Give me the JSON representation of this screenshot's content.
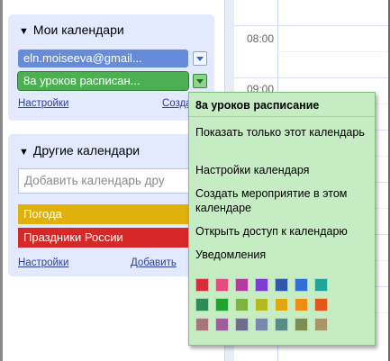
{
  "grid": {
    "times": [
      "08:00",
      "09:00"
    ]
  },
  "my_calendars": {
    "title": "Мои календари",
    "calendars": [
      {
        "label": "eln.moiseeva@gmail...",
        "color": "#668cd9"
      },
      {
        "label": "8а уроков расписан...",
        "color": "#4cb052"
      }
    ],
    "settings_link": "Настройки",
    "create_link": "Созда"
  },
  "other_calendars": {
    "title": "Другие календари",
    "add_placeholder": "Добавить календарь дру",
    "calendars": [
      {
        "label": "Погода",
        "color": "#e0b10d"
      },
      {
        "label": "Праздники России",
        "color": "#d72828"
      }
    ],
    "settings_link": "Настройки",
    "add_link": "Добавить"
  },
  "popup": {
    "title": "8а уроков расписание",
    "items": [
      "Показать только этот календарь",
      "Настройки календаря",
      "Создать мероприятие в этом календаре",
      "Открыть доступ к календарю",
      "Уведомления"
    ],
    "colors": [
      [
        "#d72d3a",
        "#e64980",
        "#b43c9a",
        "#7e3ad1",
        "#3258a8",
        "#2f6fd6",
        "#20a59a"
      ],
      [
        "#2e8b57",
        "#1fa32e",
        "#7cb342",
        "#b5b81e",
        "#e0a80e",
        "#f08c12",
        "#e2581a"
      ],
      [
        "#a5767a",
        "#9c5e9c",
        "#6d6f8a",
        "#7989ad",
        "#5a8c89",
        "#7b8f52",
        "#a89568"
      ]
    ]
  }
}
